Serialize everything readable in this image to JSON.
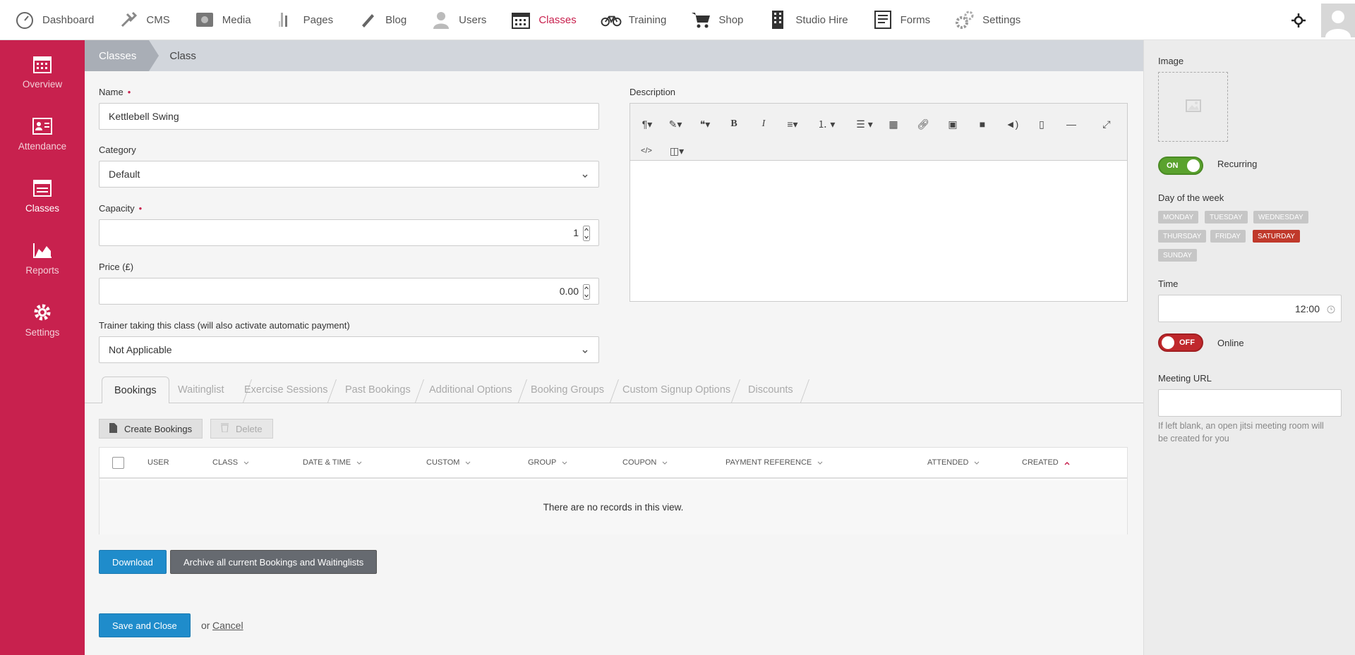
{
  "nav": {
    "items": [
      {
        "label": "Dashboard",
        "icon": "speedometer-icon"
      },
      {
        "label": "CMS",
        "icon": "tools-icon"
      },
      {
        "label": "Media",
        "icon": "camera-icon"
      },
      {
        "label": "Pages",
        "icon": "pages-icon"
      },
      {
        "label": "Blog",
        "icon": "pen-icon"
      },
      {
        "label": "Users",
        "icon": "user-icon"
      },
      {
        "label": "Classes",
        "icon": "calendar-icon",
        "active": true
      },
      {
        "label": "Training",
        "icon": "bicycle-icon"
      },
      {
        "label": "Shop",
        "icon": "cart-icon"
      },
      {
        "label": "Studio Hire",
        "icon": "building-icon"
      },
      {
        "label": "Forms",
        "icon": "form-icon"
      },
      {
        "label": "Settings",
        "icon": "gears-icon"
      }
    ]
  },
  "sidebar": {
    "items": [
      {
        "label": "Overview",
        "icon": "calendar-icon"
      },
      {
        "label": "Attendance",
        "icon": "id-card-icon"
      },
      {
        "label": "Classes",
        "icon": "list-icon",
        "active": true
      },
      {
        "label": "Reports",
        "icon": "area-chart-icon"
      },
      {
        "label": "Settings",
        "icon": "gear-icon"
      }
    ]
  },
  "breadcrumb": {
    "parent": "Classes",
    "current": "Class"
  },
  "form": {
    "name_label": "Name",
    "name_value": "Kettlebell Swing",
    "category_label": "Category",
    "category_value": "Default",
    "capacity_label": "Capacity",
    "capacity_value": "1",
    "price_label": "Price (£)",
    "price_value": "0.00",
    "trainer_label": "Trainer taking this class (will also activate automatic payment)",
    "trainer_value": "Not Applicable",
    "description_label": "Description",
    "required_mark": "•"
  },
  "tabs": [
    "Bookings",
    "Waitinglist",
    "Exercise Sessions",
    "Past Bookings",
    "Additional Options",
    "Booking Groups",
    "Custom Signup Options",
    "Discounts"
  ],
  "bookings": {
    "create_label": "Create Bookings",
    "delete_label": "Delete",
    "columns": [
      "User",
      "Class",
      "Date & Time",
      "Custom",
      "Group",
      "Coupon",
      "Payment Reference",
      "Attended",
      "Created"
    ],
    "empty_text": "There are no records in this view."
  },
  "actions": {
    "download_label": "Download",
    "archive_label": "Archive all current Bookings and Waitinglists",
    "save_label": "Save and Close",
    "or_text": "or",
    "cancel_label": "Cancel"
  },
  "right_panel": {
    "image_label": "Image",
    "recurring_toggle": "ON",
    "recurring_label": "Recurring",
    "day_label": "Day of the week",
    "days": [
      {
        "label": "MONDAY",
        "selected": false
      },
      {
        "label": "TUESDAY",
        "selected": false
      },
      {
        "label": "WEDNESDAY",
        "selected": false
      },
      {
        "label": "THURSDAY",
        "selected": false
      },
      {
        "label": "FRIDAY",
        "selected": false
      },
      {
        "label": "SATURDAY",
        "selected": true
      },
      {
        "label": "SUNDAY",
        "selected": false
      }
    ],
    "time_label": "Time",
    "time_value": "12:00",
    "online_toggle": "OFF",
    "online_label": "Online",
    "meeting_label": "Meeting URL",
    "meeting_value": "",
    "meeting_hint": "If left blank, an open jitsi meeting room will be created for you"
  },
  "colors": {
    "accent": "#c8214e",
    "primary_button": "#1f8ccb",
    "toggle_on": "#5aa22e",
    "toggle_off": "#c0282c",
    "day_selected": "#c0392b"
  }
}
